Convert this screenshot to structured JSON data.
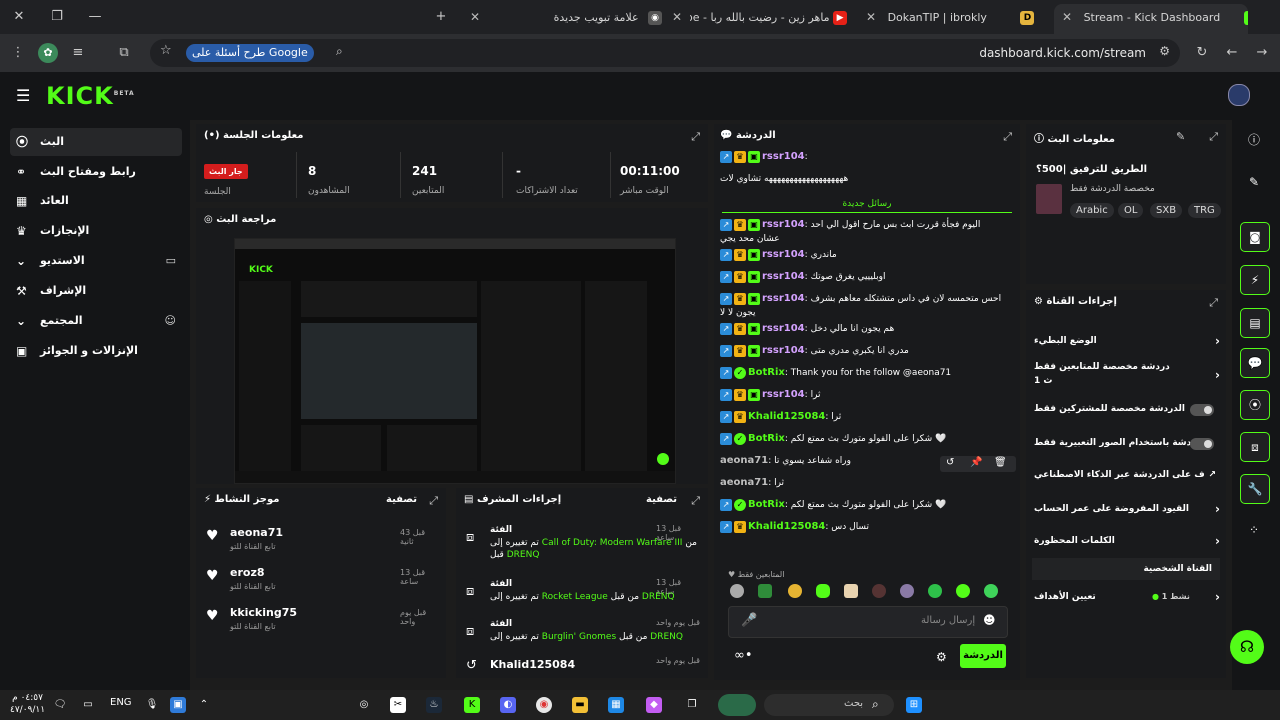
{
  "browser": {
    "tabs": [
      {
        "title": "Stream - Kick Dashboard",
        "favicon": "K"
      },
      {
        "title": "DokanTIP | ibrokly",
        "favicon": "D"
      },
      {
        "title": "ماهر زين - رضيت بالله ربا - YouTube",
        "favicon": "▶"
      },
      {
        "title": "علامة تبويب جديدة",
        "favicon": "◉"
      }
    ],
    "new_tab": "+",
    "url": "dashboard.kick.com/stream",
    "google_pill": "طرح أسئلة على Google"
  },
  "header": {
    "logo": "KICK",
    "beta": "BETA"
  },
  "nav": {
    "items": [
      {
        "label": "البث",
        "icon": "((•))"
      },
      {
        "label": "رابط ومفتاح البث",
        "icon": "⌁"
      },
      {
        "label": "العائد",
        "icon": "▦"
      },
      {
        "label": "الإنجازات",
        "icon": "🏆"
      },
      {
        "label": "الاستديو",
        "icon": "⌄",
        "extra": "▭"
      },
      {
        "label": "الإشراف",
        "icon": "⚒"
      },
      {
        "label": "المجتمع",
        "icon": "⌄",
        "extra": "👥"
      },
      {
        "label": "الإنزالات و الجوائز",
        "icon": "▣"
      }
    ]
  },
  "session": {
    "title": "معلومات الجلسة",
    "live_badge": "جار البث",
    "live_label": "الجلسة",
    "stats": [
      {
        "value": "8",
        "label": "المشاهدون"
      },
      {
        "value": "241",
        "label": "المتابعين"
      },
      {
        "value": "-",
        "label": "تعداد الاشتراكات"
      },
      {
        "value": "00:11:00",
        "label": "الوقت مباشر"
      }
    ]
  },
  "preview": {
    "title": "مراجعة البث",
    "mini_logo": "KICK"
  },
  "activity": {
    "title": "موجز النشاط",
    "filter": "تصفية",
    "items": [
      {
        "name": "aeona71",
        "sub": "تابع القناة للتو",
        "time": "قبل 43 ثانية"
      },
      {
        "name": "eroz8",
        "sub": "تابع القناة للتو",
        "time": "قبل 13 ساعة"
      },
      {
        "name": "kkicking75",
        "sub": "تابع القناة للتو",
        "time": "قبل يوم واحد"
      }
    ]
  },
  "mod": {
    "title": "إجراءات المشرف",
    "filter": "تصفية",
    "items": [
      {
        "heading": "الفئة",
        "time": "قبل 13 ساعة",
        "pre": "من قبل",
        "highlight": "Call of Duty: Modern Warfare III",
        "mid": "تم تغييره إلى",
        "target": "DRENQ"
      },
      {
        "heading": "الفئة",
        "time": "قبل 13 ساعة",
        "pre": "من قبل",
        "highlight": "Rocket League",
        "mid": "تم تغييره إلى",
        "target": "DRENQ"
      },
      {
        "heading": "الفئة",
        "time": "قبل يوم واحد",
        "pre": "من قبل",
        "highlight": "Burglin' Gnomes",
        "mid": "تم تغييره إلى",
        "target": "DRENQ"
      },
      {
        "heading": "Khalid125084",
        "time": "قبل يوم واحد"
      }
    ]
  },
  "chat": {
    "title": "الدردشة",
    "new_messages": "رسائل جديدة",
    "lines": [
      {
        "user": "rssr104",
        "cls": "uname2",
        "text": "",
        "badges": 3
      },
      {
        "user": "",
        "cls": "",
        "text": "هههههههههههههههههههه تشاوي لات",
        "badges": 0
      },
      {
        "user": "rssr104",
        "cls": "uname2",
        "text": "اليوم فجأة قررت ابث بس مارح اقول الي احد عشان محد يجي",
        "badges": 3
      },
      {
        "user": "rssr104",
        "cls": "uname2",
        "text": "ماندري",
        "badges": 3
      },
      {
        "user": "rssr104",
        "cls": "uname2",
        "text": "اوبليييي يغرق صوتك",
        "badges": 3
      },
      {
        "user": "rssr104",
        "cls": "uname2",
        "text": "احس متحمسه لان في داس متشتكله معاهم بشرف يجون لا لا",
        "badges": 3
      },
      {
        "user": "rssr104",
        "cls": "uname2",
        "text": "هم يجون انا مالي دخل",
        "badges": 3
      },
      {
        "user": "rssr104",
        "cls": "uname2",
        "text": "مدري انا يكبري مدري متى",
        "badges": 3
      },
      {
        "user": "BotRix",
        "cls": "uname",
        "text": "Thank you for the follow @aeona71",
        "badges": 2
      },
      {
        "user": "rssr104",
        "cls": "uname2",
        "text": "ثرا",
        "badges": 3
      },
      {
        "user": "Khalid125084",
        "cls": "uname",
        "text": "ثرا",
        "badges": 2
      },
      {
        "user": "BotRix",
        "cls": "uname",
        "text": "شكرا على الفولو متورك بث ممتع لكم 🤍",
        "badges": 2
      },
      {
        "user": "aeona71",
        "cls": "uname3",
        "text": "وراه شفاعد يسوي تا",
        "badges": 0
      },
      {
        "user": "aeona71",
        "cls": "uname3",
        "text": "ثرا",
        "badges": 0
      },
      {
        "user": "BotRix",
        "cls": "uname",
        "text": "شكرا على الفولو متورك بث ممتع لكم 🤍",
        "badges": 2
      },
      {
        "user": "Khalid125084",
        "cls": "uname",
        "text": "تسال دس",
        "badges": 2
      }
    ],
    "followers_only": "المتابعين فقط",
    "input_placeholder": "إرسال رسالة",
    "send_label": "الدردشة"
  },
  "stream_info": {
    "title": "معلومات البث",
    "stream_title": "الطريق للترفيق |500؟",
    "stream_sub": "مخصصة الدردشة فقط",
    "tags": [
      "Arabic",
      "OL",
      "SXB",
      "TRG"
    ]
  },
  "channel": {
    "title": "إجراءات القناة",
    "rows": [
      {
        "label": "الوضع البطيء",
        "ctrl": "chev"
      },
      {
        "label": "دردشة مخصصة للمتابعين فقط",
        "sub": "1 ث",
        "ctrl": "chev"
      },
      {
        "label": "الدردشة مخصصة للمشتركين فقط",
        "ctrl": "toggle"
      },
      {
        "label": "الدردشة باستخدام الصور التعبيرية فقط",
        "ctrl": "toggle"
      },
      {
        "label": "الإشراف على الدردشة عبر الذكاء الاصطناعي",
        "ctrl": "ext"
      },
      {
        "label": "القيود المفروضة على عمر الحساب",
        "ctrl": "chev"
      },
      {
        "label": "الكلمات المحظورة",
        "ctrl": "chev"
      }
    ],
    "personal_heading": "القناة الشخصية",
    "goals_label": "تعيين الأهداف",
    "goals_status": "نشط 1"
  },
  "taskbar": {
    "time": "٠٤:٥٧ م",
    "date": "٤٧/٠٩/١١",
    "lang": "ENG",
    "search": "بحث"
  },
  "colors": {
    "accent": "#53fc18",
    "live": "#d41d1d",
    "bg": "#1c1c1c"
  }
}
